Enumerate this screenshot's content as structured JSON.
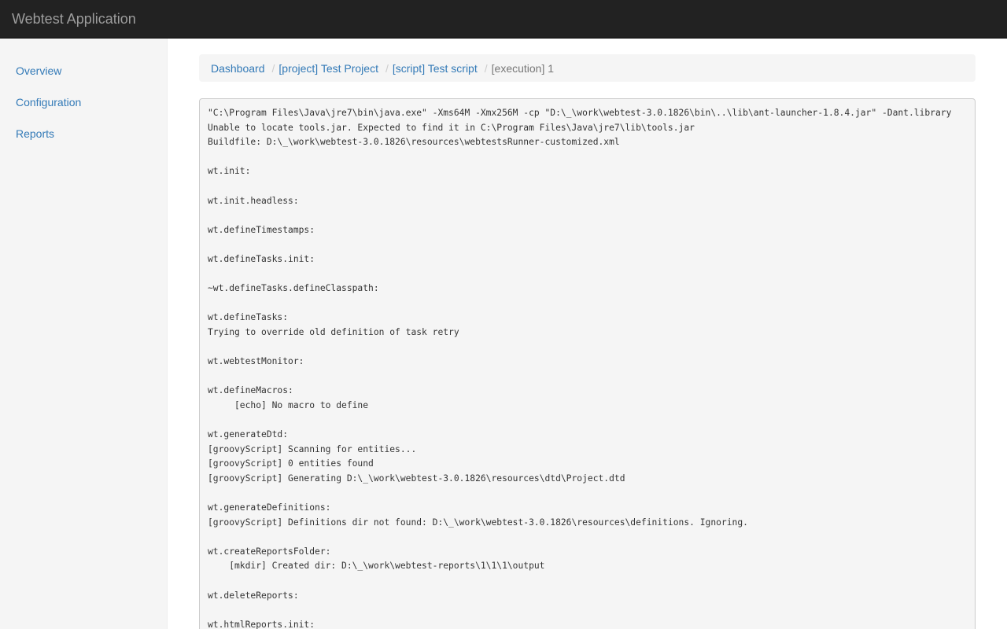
{
  "navbar": {
    "brand": "Webtest Application"
  },
  "sidebar": {
    "items": [
      {
        "label": "Overview"
      },
      {
        "label": "Configuration"
      },
      {
        "label": "Reports"
      }
    ]
  },
  "breadcrumb": {
    "dashboard": "Dashboard",
    "project": "[project] Test Project",
    "script": "[script] Test script",
    "execution": "[execution] 1",
    "separator": "/"
  },
  "console": {
    "lines": [
      "\"C:\\Program Files\\Java\\jre7\\bin\\java.exe\" -Xms64M -Xmx256M -cp \"D:\\_\\work\\webtest-3.0.1826\\bin\\..\\lib\\ant-launcher-1.8.4.jar\" -Dant.library",
      "Unable to locate tools.jar. Expected to find it in C:\\Program Files\\Java\\jre7\\lib\\tools.jar",
      "Buildfile: D:\\_\\work\\webtest-3.0.1826\\resources\\webtestsRunner-customized.xml",
      "",
      "wt.init:",
      "",
      "wt.init.headless:",
      "",
      "wt.defineTimestamps:",
      "",
      "wt.defineTasks.init:",
      "",
      "~wt.defineTasks.defineClasspath:",
      "",
      "wt.defineTasks:",
      "Trying to override old definition of task retry",
      "",
      "wt.webtestMonitor:",
      "",
      "wt.defineMacros:",
      "     [echo] No macro to define",
      "",
      "wt.generateDtd:",
      "[groovyScript] Scanning for entities...",
      "[groovyScript] 0 entities found",
      "[groovyScript] Generating D:\\_\\work\\webtest-3.0.1826\\resources\\dtd\\Project.dtd",
      "",
      "wt.generateDefinitions:",
      "[groovyScript] Definitions dir not found: D:\\_\\work\\webtest-3.0.1826\\resources\\definitions. Ignoring.",
      "",
      "wt.createReportsFolder:",
      "    [mkdir] Created dir: D:\\_\\work\\webtest-reports\\1\\1\\1\\output",
      "",
      "wt.deleteReports:",
      "",
      "wt.htmlReports.init:"
    ]
  }
}
